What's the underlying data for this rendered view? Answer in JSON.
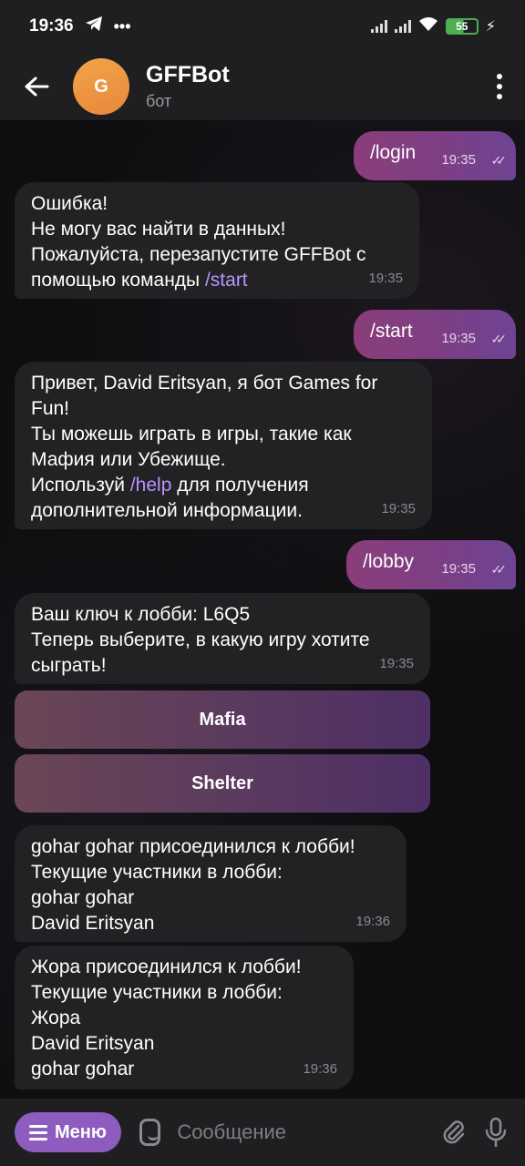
{
  "status_bar": {
    "time": "19:36",
    "battery": "55"
  },
  "header": {
    "avatar_letter": "G",
    "title": "GFFBot",
    "subtitle": "бот"
  },
  "messages": [
    {
      "side": "out",
      "text": "/login",
      "time": "19:35"
    },
    {
      "side": "in",
      "lines": [
        "Ошибка!",
        "Не могу вас найти в данных!",
        "Пожалуйста, перезапустите GFFBot с",
        "помощью команды "
      ],
      "command": "/start",
      "time": "19:35"
    },
    {
      "side": "out",
      "text": "/start",
      "time": "19:35"
    },
    {
      "side": "in",
      "lines": [
        "Привет, David Eritsyan, я бот Games for",
        "Fun!",
        "Ты можешь играть в игры, такие как",
        "Мафия или Убежище.",
        "Используй "
      ],
      "command": "/help",
      "after_command": " для получения",
      "last_line": "дополнительной информации.",
      "time": "19:35"
    },
    {
      "side": "out",
      "text": "/lobby",
      "time": "19:35"
    },
    {
      "side": "in",
      "lines": [
        "Ваш ключ к лобби: L6Q5",
        "Теперь выберите, в какую игру хотите",
        "сыграть!"
      ],
      "time": "19:35"
    },
    {
      "side": "in",
      "lines": [
        "gohar gohar присоединился к лобби!",
        "Текущие участники в лобби:",
        "gohar gohar",
        "David Eritsyan"
      ],
      "time": "19:36"
    },
    {
      "side": "in",
      "lines": [
        "Жора  присоединился к лобби!",
        "Текущие участники в лобби:",
        "Жора",
        "David Eritsyan",
        "gohar gohar"
      ],
      "time": "19:36"
    }
  ],
  "keyboard": {
    "buttons": [
      "Mafia",
      "Shelter"
    ]
  },
  "composer": {
    "menu_label": "Меню",
    "placeholder": "Сообщение"
  },
  "colors": {
    "outgoing_bubble": "#7b3f86",
    "incoming_bubble": "#222225",
    "command_link": "#b892ff",
    "menu_button": "#8e5bbf"
  }
}
